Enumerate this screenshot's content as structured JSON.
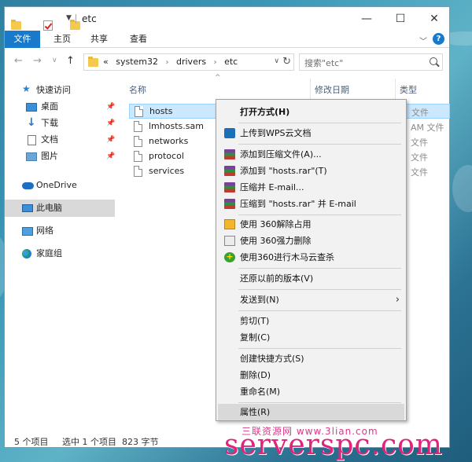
{
  "window": {
    "title": "etc",
    "minimize_glyph": "—",
    "maximize_glyph": "☐",
    "close_glyph": "✕"
  },
  "ribbon": {
    "tabs": [
      "文件",
      "主页",
      "共享",
      "查看"
    ],
    "help_glyph": "?",
    "accent_color": "#1979ca"
  },
  "address_bar": {
    "crumbs": [
      "«",
      "system32",
      "drivers",
      "etc"
    ],
    "search_placeholder": "搜索\"etc\""
  },
  "nav_pane": {
    "quick_access": "快速访问",
    "quick_items": [
      "桌面",
      "下载",
      "文档",
      "图片"
    ],
    "onedrive": "OneDrive",
    "this_pc": "此电脑",
    "network": "网络",
    "homegroup": "家庭组"
  },
  "columns": {
    "name": "名称",
    "date_modified": "修改日期",
    "type": "类型"
  },
  "files": [
    {
      "name": "hosts",
      "type": "文件"
    },
    {
      "name": "lmhosts.sam",
      "type": "AM 文件"
    },
    {
      "name": "networks",
      "type": "文件"
    },
    {
      "name": "protocol",
      "type": "文件"
    },
    {
      "name": "services",
      "type": "文件"
    }
  ],
  "status_bar": {
    "item_count": "5 个项目",
    "selection": "选中 1 个项目",
    "size": "823 字节"
  },
  "context_menu": {
    "open_with": "打开方式(H)",
    "upload_wps": "上传到WPS云文档",
    "add_archive": "添加到压缩文件(A)...",
    "add_hosts_rar": "添加到 \"hosts.rar\"(T)",
    "compress_email": "压缩并 E-mail...",
    "compress_hosts_email": "压缩到 \"hosts.rar\" 并 E-mail",
    "unlock_360": "使用 360解除占用",
    "force_delete_360": "使用 360强力删除",
    "trojan_scan_360": "使用360进行木马云查杀",
    "restore_versions": "还原以前的版本(V)",
    "send_to": "发送到(N)",
    "cut": "剪切(T)",
    "copy": "复制(C)",
    "create_shortcut": "创建快捷方式(S)",
    "delete": "删除(D)",
    "rename": "重命名(M)",
    "properties": "属性(R)"
  },
  "watermark": {
    "small_text": "三联资源网 www.3lian.com",
    "big_text": "serverspc.com"
  }
}
